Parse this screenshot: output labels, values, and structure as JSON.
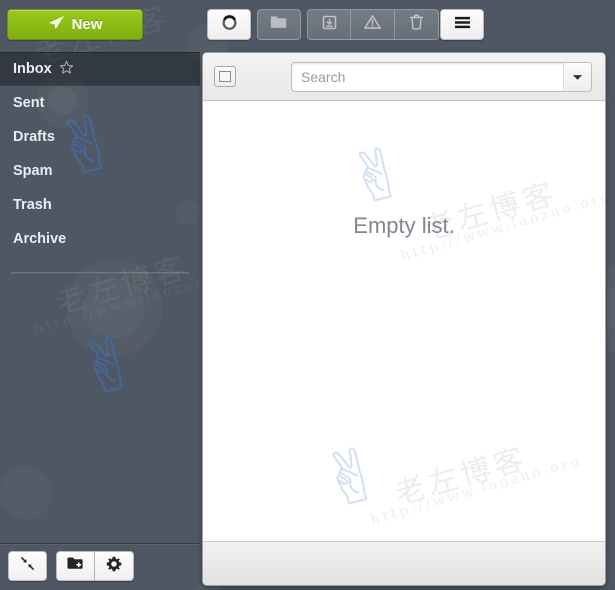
{
  "sidebar": {
    "new_button": {
      "label": "New",
      "icon": "paper-plane-icon",
      "color": "#8dbc14"
    },
    "folders": [
      {
        "label": "Inbox",
        "selected": true,
        "starred": true
      },
      {
        "label": "Sent",
        "selected": false,
        "starred": false
      },
      {
        "label": "Drafts",
        "selected": false,
        "starred": false
      },
      {
        "label": "Spam",
        "selected": false,
        "starred": false
      },
      {
        "label": "Trash",
        "selected": false,
        "starred": false
      },
      {
        "label": "Archive",
        "selected": false,
        "starred": false
      }
    ],
    "footer_buttons": [
      {
        "name": "collapse-button",
        "icon": "collapse-arrows-icon"
      },
      {
        "name": "add-folder-button",
        "icon": "folder-plus-icon"
      },
      {
        "name": "settings-button",
        "icon": "gear-icon"
      }
    ]
  },
  "toolbar": {
    "buttons": [
      {
        "name": "refresh-button",
        "icon": "circle-refresh-icon",
        "enabled": true
      },
      {
        "name": "move-to-folder-button",
        "icon": "folder-icon",
        "enabled": false
      },
      {
        "name": "archive-button",
        "icon": "archive-box-icon",
        "enabled": false
      },
      {
        "name": "spam-button",
        "icon": "warning-triangle-icon",
        "enabled": false
      },
      {
        "name": "delete-button",
        "icon": "trash-can-icon",
        "enabled": false
      },
      {
        "name": "more-menu-button",
        "icon": "hamburger-menu-icon",
        "enabled": true
      }
    ]
  },
  "list_panel": {
    "select_all_checkbox": {
      "checked": false
    },
    "search": {
      "value": "",
      "placeholder": "Search"
    },
    "search_dropdown_icon": "chevron-down-icon",
    "empty_message": "Empty list."
  },
  "watermark": {
    "cn_text": "老左博客",
    "url_text": "http://www.laozuo.org"
  },
  "colors": {
    "accent_green": "#8dbc14",
    "sidebar_bg": "#4e5763",
    "panel_bg": "#ffffff",
    "watermark_blue": "#3f72c4"
  }
}
